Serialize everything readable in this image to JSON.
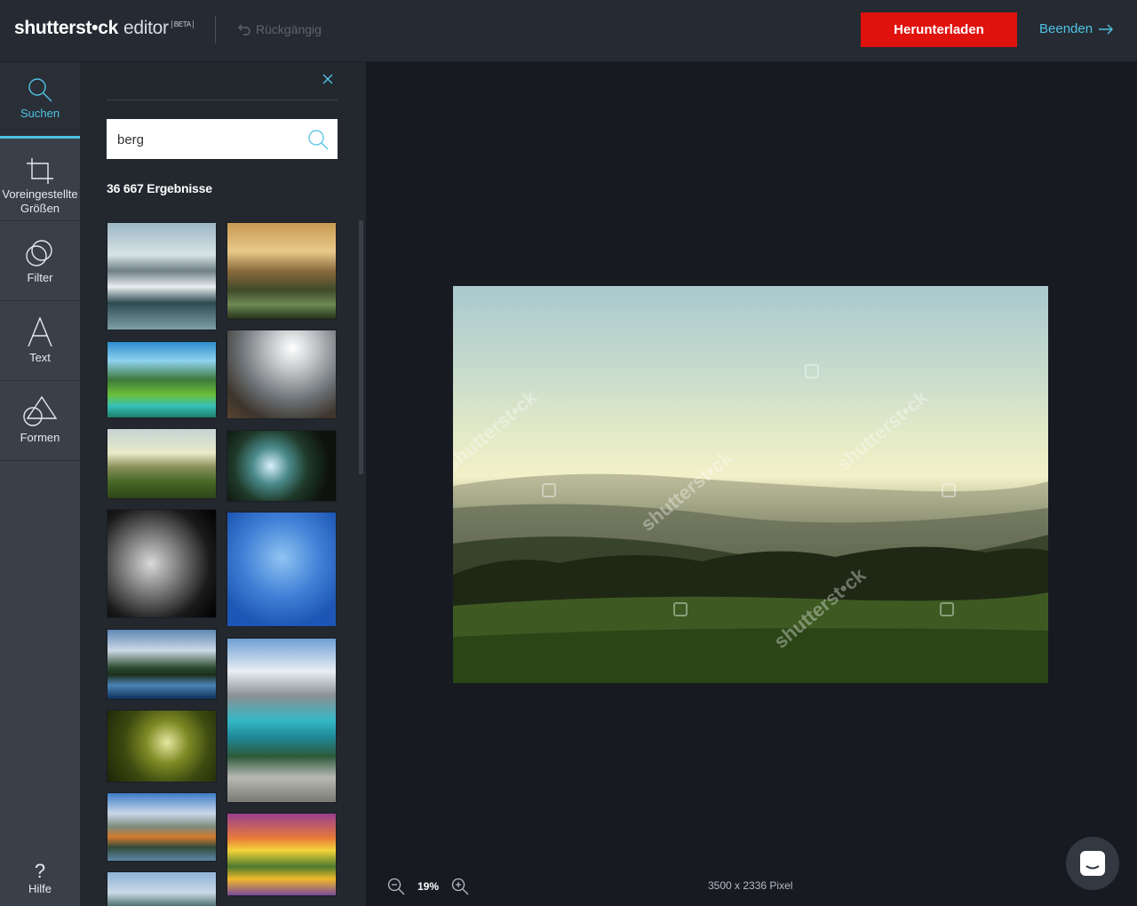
{
  "header": {
    "brand": "shutterst•ck",
    "product": "editor",
    "beta": "BETA",
    "undo_label": "Rückgängig",
    "download_label": "Herunterladen",
    "exit_label": "Beenden"
  },
  "rail": {
    "items": [
      {
        "label": "Suchen",
        "icon": "search-icon",
        "active": true
      },
      {
        "label": "Voreingestellte Größen",
        "icon": "crop-icon"
      },
      {
        "label": "Filter",
        "icon": "filter-icon"
      },
      {
        "label": "Text",
        "icon": "text-icon"
      },
      {
        "label": "Formen",
        "icon": "shapes-icon"
      }
    ],
    "help_symbol": "?",
    "help_label": "Hilfe"
  },
  "search": {
    "query": "berg",
    "results_text": "36 667 Ergebnisse"
  },
  "canvas": {
    "zoom": "19%",
    "dimensions": "3500 x 2336 Pixel",
    "watermark": "shutterst•ck"
  },
  "colors": {
    "accent": "#4fc3e3",
    "download": "#e0120e"
  }
}
